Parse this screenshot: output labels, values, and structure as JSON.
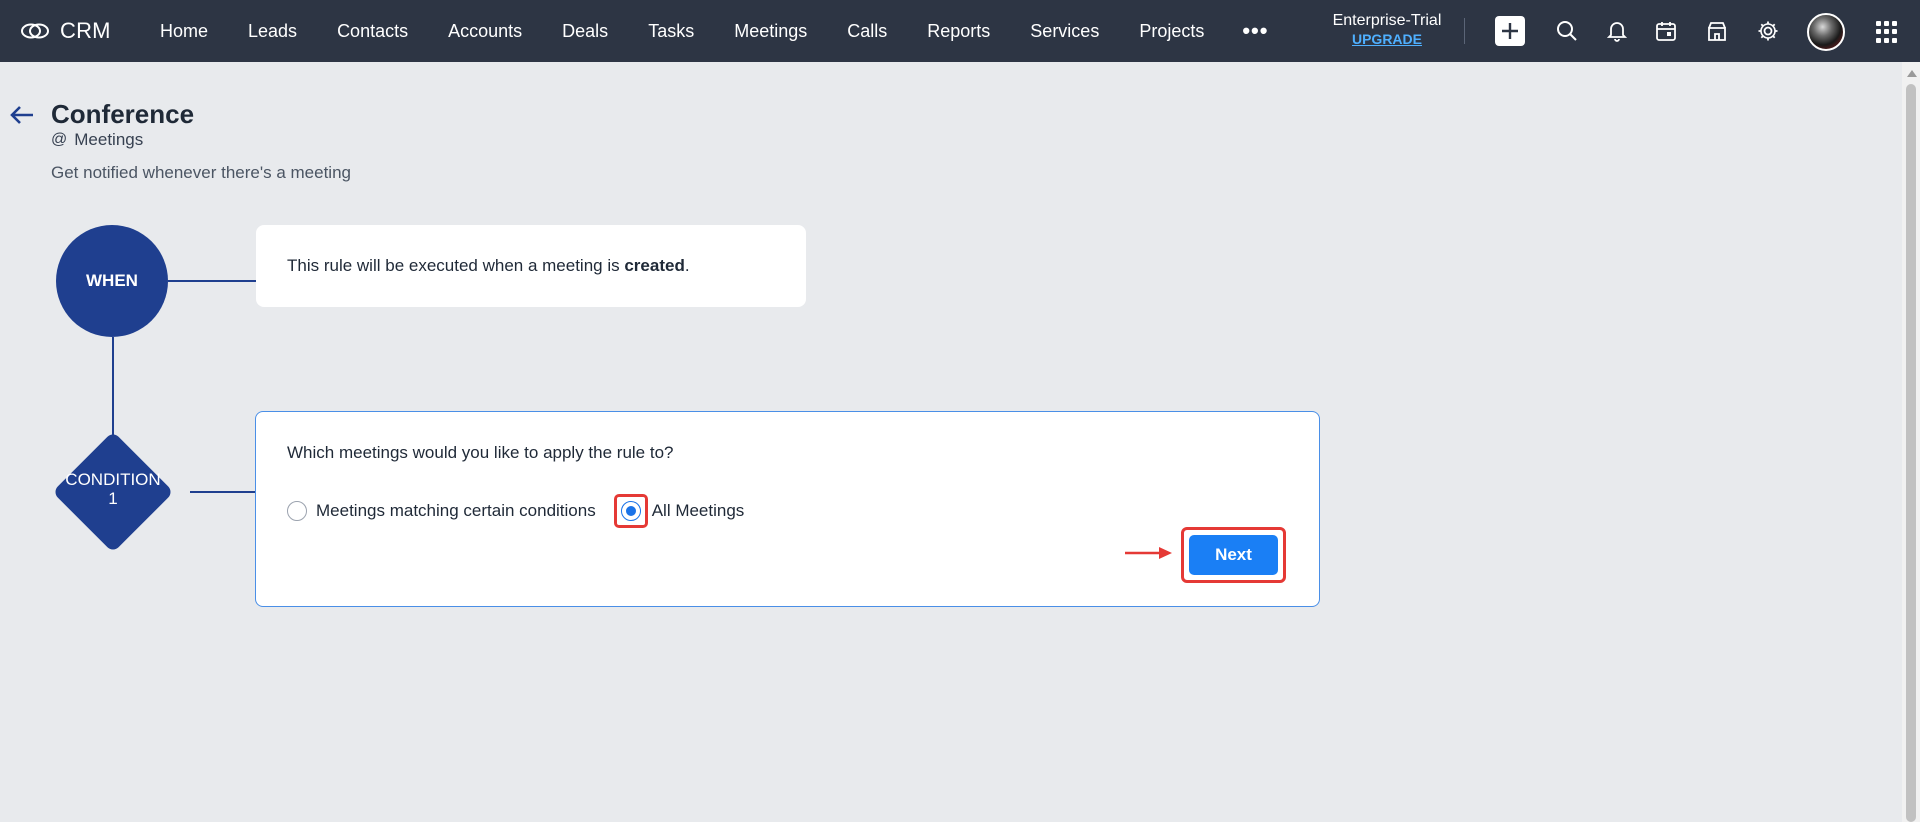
{
  "app": {
    "brand": "CRM",
    "nav_items": [
      "Home",
      "Leads",
      "Contacts",
      "Accounts",
      "Deals",
      "Tasks",
      "Meetings",
      "Calls",
      "Reports",
      "Services",
      "Projects"
    ],
    "more_label": "•••",
    "edition": "Enterprise-Trial",
    "upgrade_label": "UPGRADE",
    "icons": [
      "plus-icon",
      "search-icon",
      "bell-icon",
      "calendar-icon",
      "store-icon",
      "gear-icon",
      "avatar",
      "apps-grid-icon"
    ]
  },
  "page": {
    "title": "Conference",
    "module_prefix": "@",
    "module": "Meetings",
    "description": "Get notified whenever there's a meeting"
  },
  "flow": {
    "when_label": "WHEN",
    "when_text_before": "This rule will be executed when a meeting is ",
    "when_text_bold": "created",
    "when_text_after": ".",
    "condition_label": "CONDITION",
    "condition_number": "1",
    "question": "Which meetings would you like to apply the rule to?",
    "option_conditions": "Meetings matching certain conditions",
    "option_all": "All Meetings",
    "selected_option": "All Meetings",
    "next_label": "Next"
  },
  "colors": {
    "topbar": "#2d3544",
    "node": "#1f3f8f",
    "primary": "#1a7ff5",
    "highlight": "#e53935",
    "upgrade": "#4fb0ff"
  }
}
